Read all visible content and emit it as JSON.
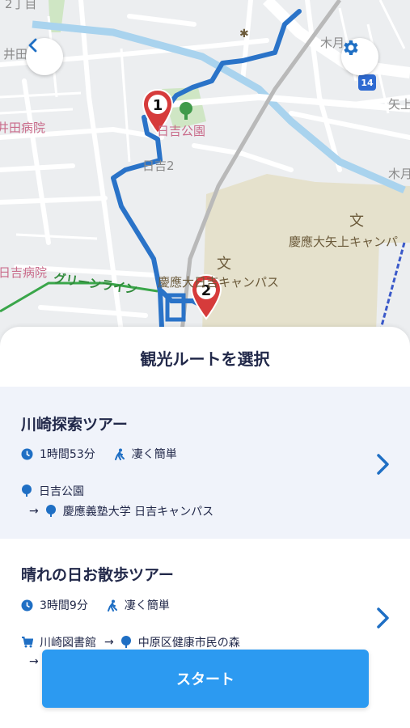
{
  "map": {
    "labels": {
      "area_top_left": "2丁目",
      "area_top_left2": "井田",
      "hospital1": "井田病院",
      "park": "日吉公園",
      "district": "日吉2",
      "hospital2": "日吉病院",
      "green_line": "グリーンライン",
      "campus_label": "慶應大日吉キャンパス",
      "campus_right": "慶應大矢上キャンパ",
      "kizuki": "木月",
      "tsukimi": "木月",
      "yatama": "矢上",
      "route_shield": "14"
    },
    "pins": [
      {
        "number": "1",
        "color": "#d63b3b"
      },
      {
        "number": "2",
        "color": "#d63b3b"
      }
    ],
    "route_color": "#2a73c8"
  },
  "sheet": {
    "title": "観光ルートを選択"
  },
  "tours": [
    {
      "name": "川崎探索ツアー",
      "duration": "1時間53分",
      "difficulty": "凄く簡単",
      "stops": [
        "日吉公園",
        "慶應義塾大学 日吉キャンパス"
      ]
    },
    {
      "name": "晴れの日お散歩ツアー",
      "duration": "3時間9分",
      "difficulty": "凄く簡単",
      "stops": [
        "川崎図書館",
        "中原区健康市民の森"
      ]
    }
  ],
  "start_button": "スタート",
  "colors": {
    "accent": "#2c9af1",
    "icon_blue": "#1f6fc4",
    "highlight_bg": "#f0f3fa"
  }
}
